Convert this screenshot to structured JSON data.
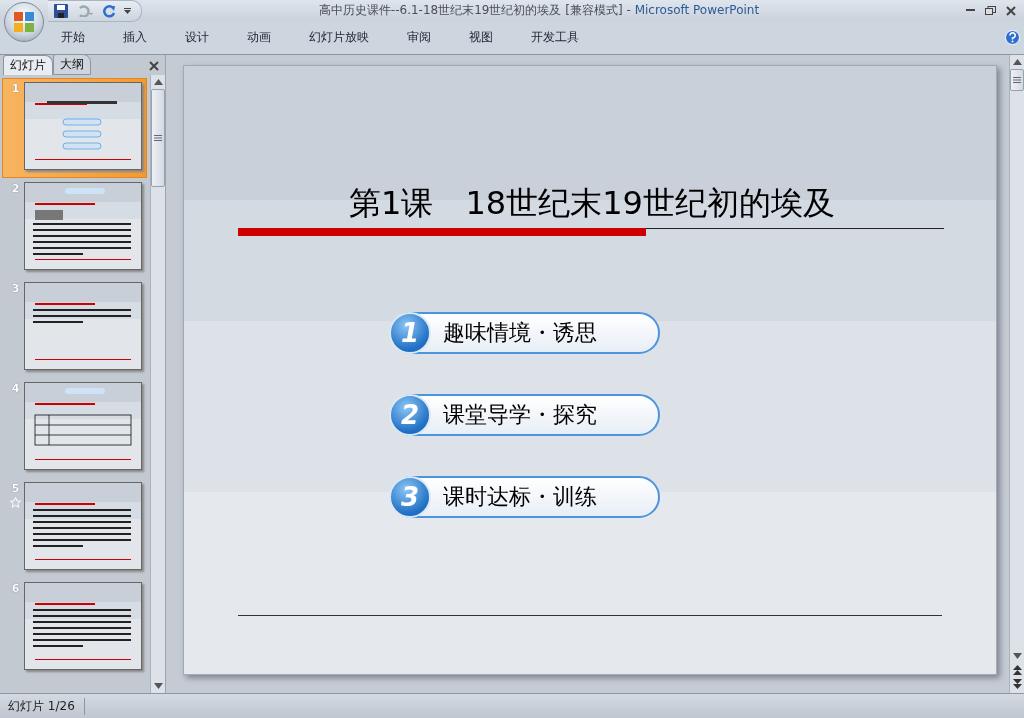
{
  "window": {
    "title": "高中历史课件--6.1-18世纪末19世纪初的埃及 [兼容模式] -",
    "app_name": "Microsoft PowerPoint"
  },
  "ribbon_tabs": [
    {
      "label": "开始"
    },
    {
      "label": "插入"
    },
    {
      "label": "设计"
    },
    {
      "label": "动画"
    },
    {
      "label": "幻灯片放映"
    },
    {
      "label": "审阅"
    },
    {
      "label": "视图"
    },
    {
      "label": "开发工具"
    }
  ],
  "panel_tabs": [
    {
      "label": "幻灯片",
      "selected": true
    },
    {
      "label": "大纲",
      "selected": false
    }
  ],
  "thumbnails": [
    {
      "number": "1",
      "kind": "title",
      "selected": true,
      "animated": false
    },
    {
      "number": "2",
      "kind": "picture",
      "selected": false,
      "animated": false
    },
    {
      "number": "3",
      "kind": "short",
      "selected": false,
      "animated": false
    },
    {
      "number": "4",
      "kind": "table",
      "selected": false,
      "animated": false
    },
    {
      "number": "5",
      "kind": "text",
      "selected": false,
      "animated": true
    },
    {
      "number": "6",
      "kind": "text",
      "selected": false,
      "animated": false
    }
  ],
  "slide": {
    "title_lesson": "第1课",
    "title_topic": "18世纪末19世纪初的埃及",
    "items": [
      {
        "number": "1",
        "label": "趣味情境・诱思"
      },
      {
        "number": "2",
        "label": "课堂导学・探究"
      },
      {
        "number": "3",
        "label": "课时达标・训练"
      }
    ]
  },
  "status_bar": {
    "slide_counter": "幻灯片 1/26"
  }
}
